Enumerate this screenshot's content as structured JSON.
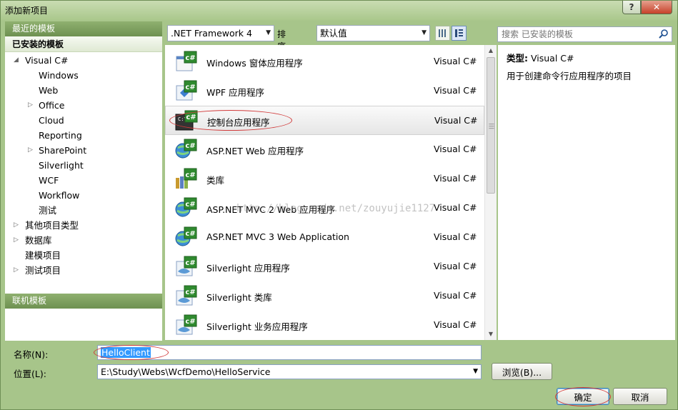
{
  "window": {
    "title": "添加新项目",
    "help": "?",
    "close": "✕"
  },
  "left_panel": {
    "recent_header": "最近的模板",
    "installed_title": "已安装的模板",
    "tree": [
      {
        "label": "Visual C#",
        "arrow": "◢"
      },
      {
        "label": "Windows",
        "arrow": ""
      },
      {
        "label": "Web",
        "arrow": ""
      },
      {
        "label": "Office",
        "arrow": "▷"
      },
      {
        "label": "Cloud",
        "arrow": ""
      },
      {
        "label": "Reporting",
        "arrow": ""
      },
      {
        "label": "SharePoint",
        "arrow": "▷"
      },
      {
        "label": "Silverlight",
        "arrow": ""
      },
      {
        "label": "WCF",
        "arrow": ""
      },
      {
        "label": "Workflow",
        "arrow": ""
      },
      {
        "label": "测试",
        "arrow": ""
      },
      {
        "label": "其他项目类型",
        "arrow": "▷"
      },
      {
        "label": "数据库",
        "arrow": "▷"
      },
      {
        "label": "建模项目",
        "arrow": ""
      },
      {
        "label": "测试项目",
        "arrow": "▷"
      }
    ],
    "online_header": "联机模板"
  },
  "toolbar": {
    "framework": ".NET Framework 4",
    "sort_label": "排序依据:",
    "sort_value": "默认值"
  },
  "search": {
    "placeholder": "搜索 已安装的模板"
  },
  "templates": [
    {
      "name": "Windows 窗体应用程序",
      "lang": "Visual C#",
      "icon": "winforms-icon"
    },
    {
      "name": "WPF 应用程序",
      "lang": "Visual C#",
      "icon": "wpf-icon"
    },
    {
      "name": "控制台应用程序",
      "lang": "Visual C#",
      "icon": "console-icon"
    },
    {
      "name": "ASP.NET Web 应用程序",
      "lang": "Visual C#",
      "icon": "aspnet-web-icon"
    },
    {
      "name": "类库",
      "lang": "Visual C#",
      "icon": "class-library-icon"
    },
    {
      "name": "ASP.NET MVC 2 Web 应用程序",
      "lang": "Visual C#",
      "icon": "mvc2-icon"
    },
    {
      "name": "ASP.NET MVC 3 Web Application",
      "lang": "Visual C#",
      "icon": "mvc3-icon"
    },
    {
      "name": "Silverlight 应用程序",
      "lang": "Visual C#",
      "icon": "silverlight-app-icon"
    },
    {
      "name": "Silverlight 类库",
      "lang": "Visual C#",
      "icon": "silverlight-library-icon"
    },
    {
      "name": "Silverlight 业务应用程序",
      "lang": "Visual C#",
      "icon": "silverlight-business-icon"
    }
  ],
  "selected_template": 2,
  "description": {
    "type_label": "类型:",
    "type_value": "Visual C#",
    "text": "用于创建命令行应用程序的项目"
  },
  "form": {
    "name_label": "名称(N):",
    "name_value": "HelloClient",
    "location_label": "位置(L):",
    "location_value": "E:\\Study\\Webs\\WcfDemo\\HelloService",
    "browse": "浏览(B)..."
  },
  "buttons": {
    "ok": "确定",
    "cancel": "取消"
  },
  "watermark": "http://blog.csdn.net/zouyujie1127",
  "colors": {
    "frame": "#a7c58a",
    "header": "#6e9151",
    "annotation": "#d13a3a",
    "selection": "#3399ff"
  }
}
